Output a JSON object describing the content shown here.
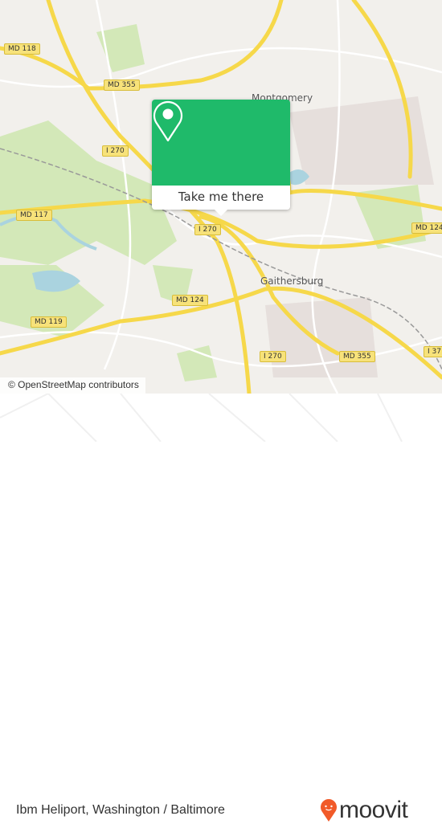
{
  "map": {
    "road_labels": [
      "MD 118",
      "MD 355",
      "I 270",
      "MD 117",
      "I 270",
      "MD 124",
      "MD 119",
      "I 270",
      "MD 355",
      "MD 124",
      "I 37"
    ],
    "places": [
      "Montgomery Village",
      "Gaithersburg"
    ],
    "attribution": "© OpenStreetMap contributors",
    "colors": {
      "land": "#f2f0ec",
      "park": "#d3e8b8",
      "water": "#aad3df",
      "highway": "#f6d84a"
    }
  },
  "popup": {
    "icon": "location-pin-icon",
    "button_label": "Take me there",
    "color": "#1fba6a"
  },
  "footer": {
    "place_name": "Ibm Heliport, Washington / Baltimore",
    "brand": "moovit",
    "brand_color": "#f15a29"
  }
}
